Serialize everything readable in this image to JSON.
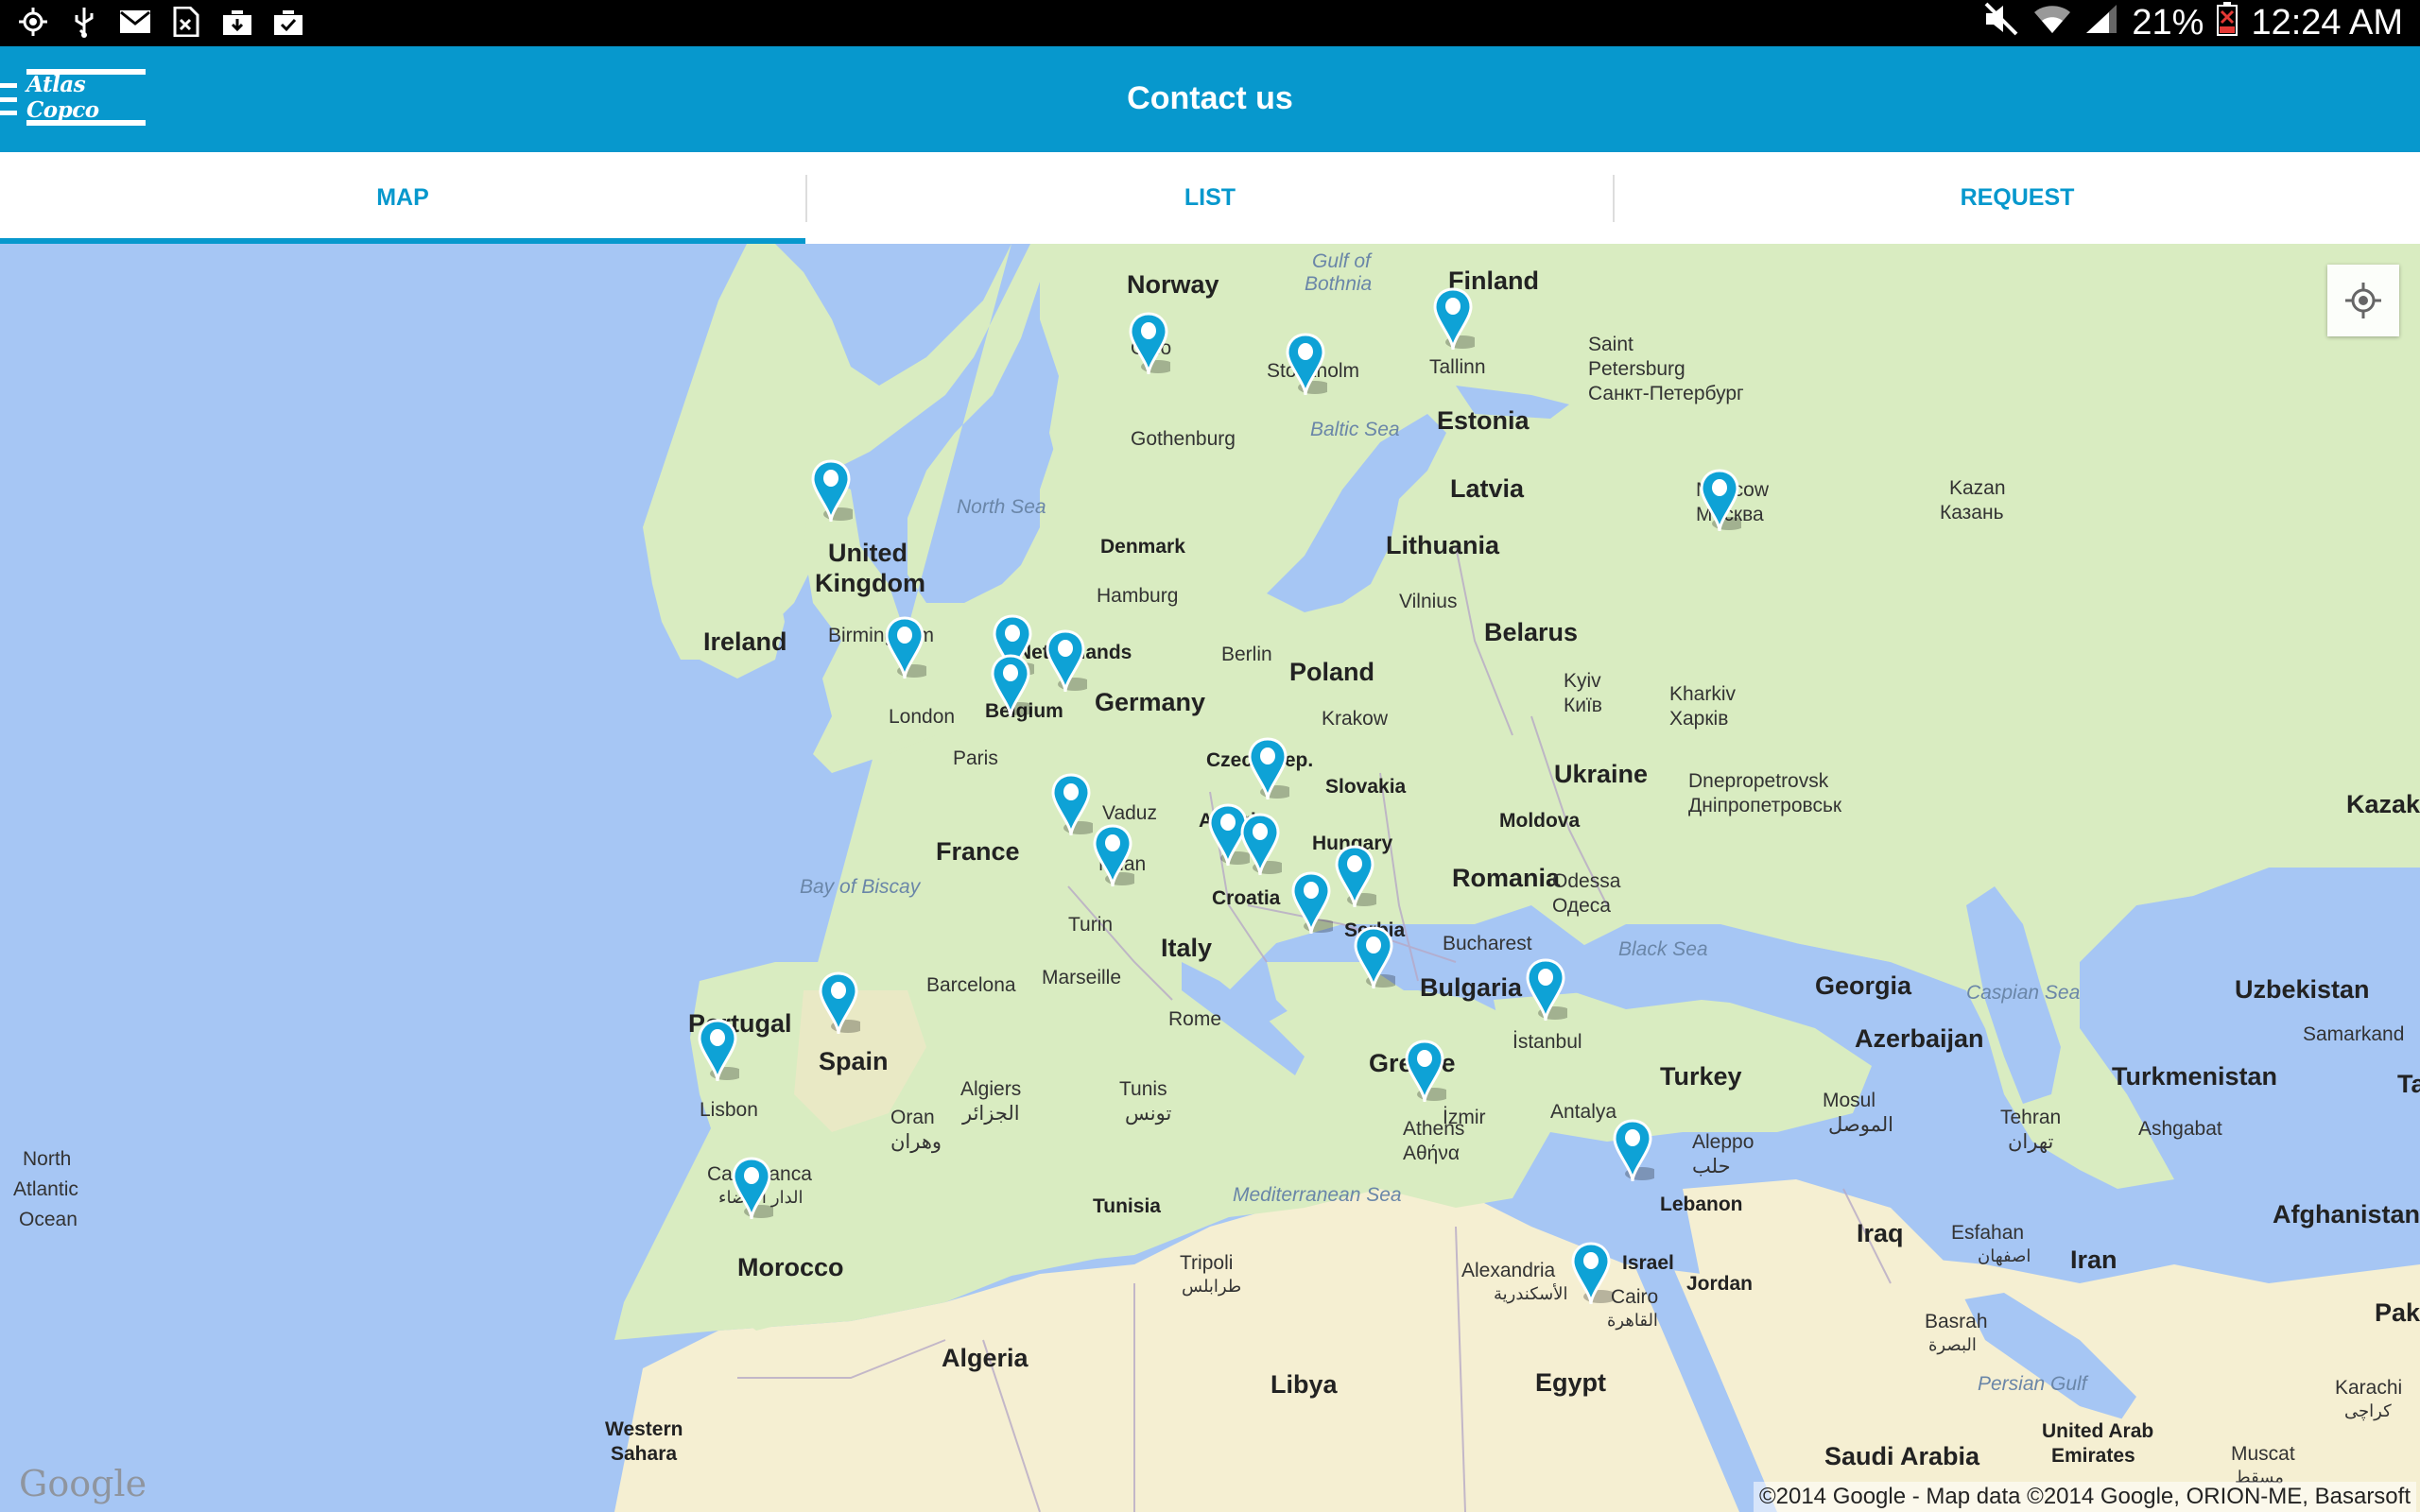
{
  "status_bar": {
    "battery_percent": "21%",
    "time": "12:24 AM",
    "left_icons": [
      "gps-icon",
      "usb-icon",
      "gmail-icon",
      "sim-icon",
      "download-icon",
      "briefcase-check-icon"
    ],
    "right_icons": [
      "mute-icon",
      "wifi-icon",
      "signal-icon",
      "battery-icon"
    ]
  },
  "app_bar": {
    "logo_text": "Atlas Copco",
    "title": "Contact us"
  },
  "tabs": [
    {
      "label": "MAP",
      "active": true
    },
    {
      "label": "LIST",
      "active": false
    },
    {
      "label": "REQUEST",
      "active": false
    }
  ],
  "map": {
    "labels": {
      "norway": "Norway",
      "finland": "Finland",
      "gulf_bothnia_1": "Gulf of",
      "gulf_bothnia_2": "Bothnia",
      "saint_1": "Saint",
      "saint_2": "Petersburg",
      "saint_3": "Санкт-Петербург",
      "tallinn": "Tallinn",
      "estonia": "Estonia",
      "stockholm": "Stockholm",
      "oslo": "Oslo",
      "baltic_sea": "Baltic Sea",
      "gothenburg": "Gothenburg",
      "latvia": "Latvia",
      "moscow_1": "Moscow",
      "moscow_2": "Москва",
      "kazan_1": "Kazan",
      "kazan_2": "Казань",
      "north_sea": "North Sea",
      "uk_1": "United",
      "uk_2": "Kingdom",
      "denmark": "Denmark",
      "lithuania": "Lithuania",
      "vilnius": "Vilnius",
      "hamburg": "Hamburg",
      "ireland": "Ireland",
      "birmingham": "Birmingham",
      "netherlands": "Netherlands",
      "berlin": "Berlin",
      "poland": "Poland",
      "belarus": "Belarus",
      "london": "London",
      "belgium": "Belgium",
      "germany": "Germany",
      "kyiv_1": "Kyiv",
      "kyiv_2": "Київ",
      "kharkiv_1": "Kharkiv",
      "kharkiv_2": "Харків",
      "krakow": "Krakow",
      "paris": "Paris",
      "czech": "Czech Rep.",
      "ukraine": "Ukraine",
      "dnipro_1": "Dnepropetrovsk",
      "dnipro_2": "Дніпропетровськ",
      "slovakia": "Slovakia",
      "kazakhstan": "Kazakhsta",
      "vaduz": "Vaduz",
      "france": "France",
      "austria": "Austria",
      "moldova": "Moldova",
      "hungary": "Hungary",
      "bay_biscay": "Bay of Biscay",
      "milan": "Milan",
      "croatia": "Croatia",
      "romania": "Romania",
      "odessa_1": "Odessa",
      "odessa_2": "Одеса",
      "turin": "Turin",
      "serbia": "Serbia",
      "bucharest": "Bucharest",
      "italy": "Italy",
      "black_sea": "Black Sea",
      "barcelona": "Barcelona",
      "marseille": "Marseille",
      "bulgaria": "Bulgaria",
      "georgia": "Georgia",
      "caspian_sea": "Caspian Sea",
      "uzbekistan": "Uzbekistan",
      "portugal": "Portugal",
      "rome": "Rome",
      "istanbul": "İstanbul",
      "azerbaijan": "Azerbaijan",
      "samarkand": "Samarkand",
      "spain": "Spain",
      "greece": "Greece",
      "turkey": "Turkey",
      "turkmenistan": "Turkmenistan",
      "algiers_1": "Algiers",
      "algiers_2": "الجزائر",
      "tunis_1": "Tunis",
      "tunis_2": "تونس",
      "lisbon": "Lisbon",
      "oran_1": "Oran",
      "oran_2": "وهران",
      "izmir": "İzmir",
      "antalya": "Antalya",
      "mosul_1": "Mosul",
      "mosul_2": "الموصل",
      "tehran_1": "Tehran",
      "tehran_2": "تهران",
      "ashgabat": "Ashgabat",
      "athens_1": "Athens",
      "athens_2": "Αθήνα",
      "aleppo_1": "Aleppo",
      "aleppo_2": "حلب",
      "north_atlantic_1": "North",
      "north_atlantic_2": "Atlantic",
      "north_atlantic_3": "Ocean",
      "casablanca_1": "Casablanca",
      "casablanca_2": "الدار البيضاء",
      "tunisia": "Tunisia",
      "med_sea": "Mediterranean Sea",
      "lebanon": "Lebanon",
      "afghanistan": "Afghanistan",
      "iraq": "Iraq",
      "esfahan_1": "Esfahan",
      "esfahan_2": "اصفهان",
      "iran": "Iran",
      "morocco": "Morocco",
      "tripoli_1": "Tripoli",
      "tripoli_2": "طرابلس",
      "alexandria_1": "Alexandria",
      "alexandria_2": "الأسكندرية",
      "israel": "Israel",
      "jordan": "Jordan",
      "cairo_1": "Cairo",
      "cairo_2": "القاهرة",
      "basrah_1": "Basrah",
      "basrah_2": "البصرة",
      "pakistan": "Paki",
      "algeria": "Algeria",
      "libya": "Libya",
      "egypt": "Egypt",
      "persian_gulf": "Persian Gulf",
      "karachi_1": "Karachi",
      "karachi_2": "کراچی",
      "western_sahara_1": "Western",
      "western_sahara_2": "Sahara",
      "saudi_arabia": "Saudi Arabia",
      "uae_1": "United Arab",
      "uae_2": "Emirates",
      "muscat_1": "Muscat",
      "muscat_2": "مسقط",
      "ta": "Ta"
    },
    "pin_count": 25,
    "google_logo": "Google",
    "attribution": "©2014 Google - Map data ©2014 Google, ORION-ME, Basarsoft"
  },
  "colors": {
    "accent": "#0798cd",
    "water": "#a6c6f4",
    "land": "#d8ecc1",
    "desert": "#f5efd2"
  }
}
